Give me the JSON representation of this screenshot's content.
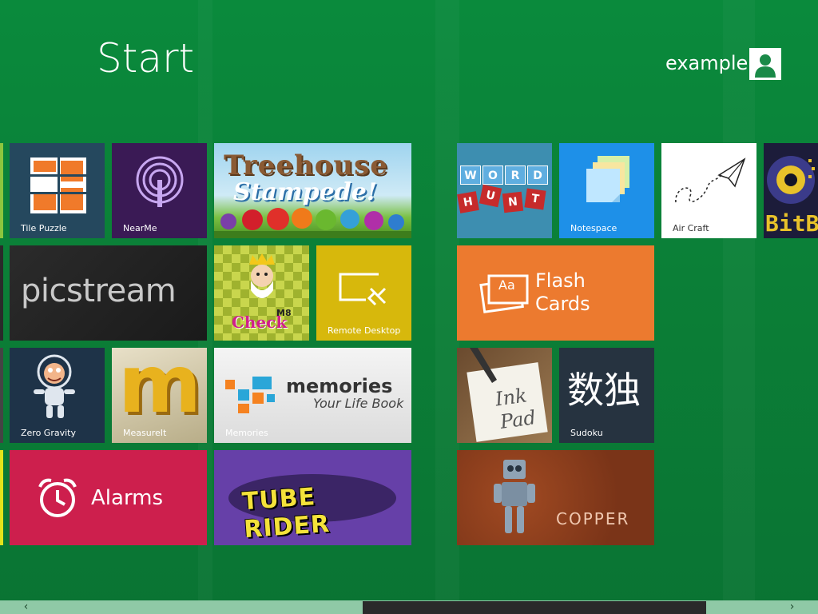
{
  "header": {
    "title": "Start",
    "username": "example"
  },
  "tiles": {
    "tile_puzzle": "Tile Puzzle",
    "nearme": "NearMe",
    "treehouse_line1": "Treehouse",
    "treehouse_line2": "Stampede!",
    "picstream": "picstream",
    "check_word": "Check",
    "check_badge": "M8",
    "remote_desktop": "Remote Desktop",
    "zero_gravity": "Zero Gravity",
    "measureit": "MeasureIt",
    "memories_title": "memories",
    "memories_sub": "Your Life Book",
    "memories_label": "Memories",
    "alarms": "Alarms",
    "tube_rider": "TUBE RIDER",
    "wordhunt_letters": [
      "W",
      "O",
      "R",
      "D",
      "H",
      "U",
      "N",
      "T"
    ],
    "notespace": "Notespace",
    "aircraft": "Air Craft",
    "bitb": "BitB",
    "flash_line1": "Flash",
    "flash_line2": "Cards",
    "flash_icon_text": "Aa",
    "inkpad_line1": "Ink",
    "inkpad_line2": "Pad",
    "sudoku_chars": "数独",
    "sudoku_label": "Sudoku",
    "copper": "COPPER"
  },
  "scrollbar": {
    "left_arrow": "‹",
    "right_arrow": "›"
  },
  "colors": {
    "background": "#0a8a3c",
    "tile_puzzle": "#25485e",
    "nearme": "#3a1a55",
    "remote_desktop": "#d7b80c",
    "notespace": "#1e90e8",
    "flash_cards": "#ec7a2f",
    "sudoku": "#263340",
    "alarms": "#cd1f4d",
    "tube_rider": "#6640a8",
    "copper": "#7a3418"
  }
}
